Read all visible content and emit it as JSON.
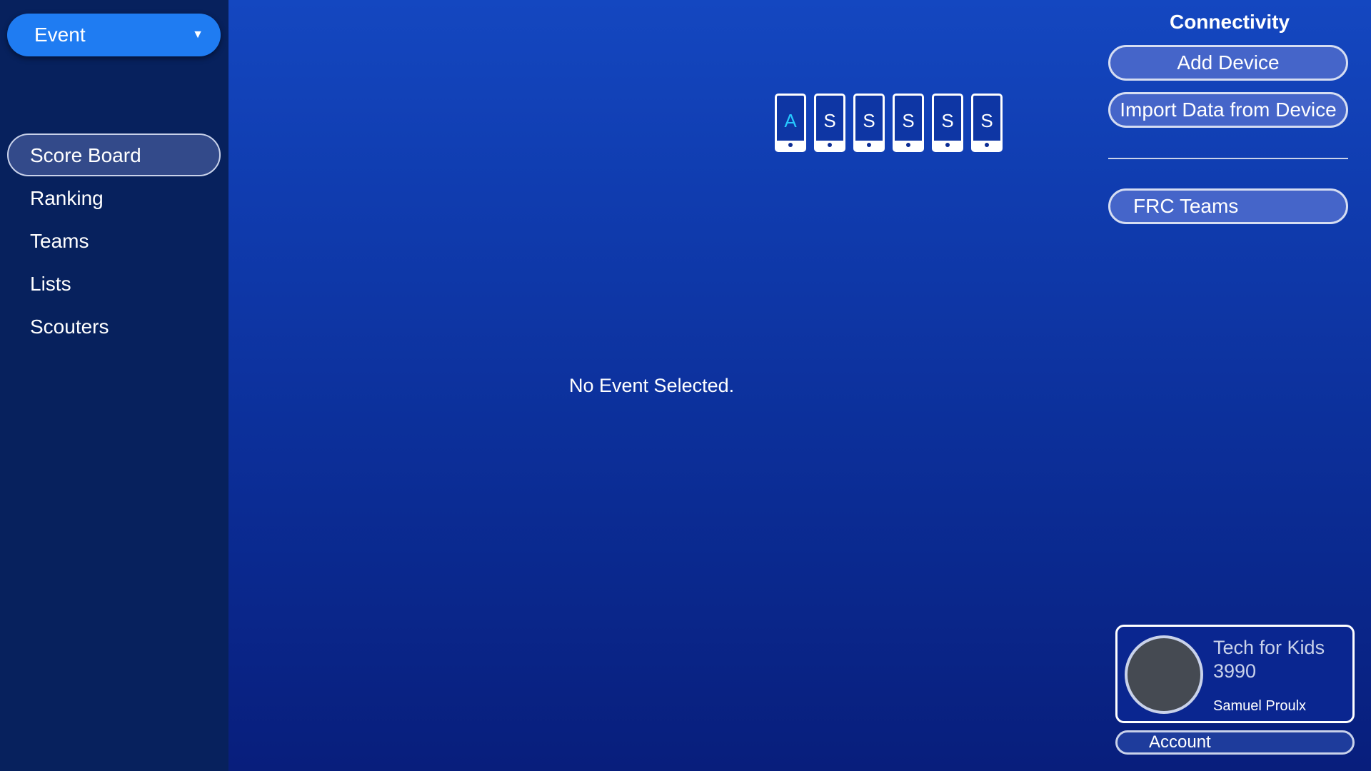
{
  "sidebar": {
    "event_dropdown": {
      "label": "Event",
      "caret": "▼"
    },
    "items": [
      {
        "label": "Score Board",
        "active": true
      },
      {
        "label": "Ranking",
        "active": false
      },
      {
        "label": "Teams",
        "active": false
      },
      {
        "label": "Lists",
        "active": false
      },
      {
        "label": "Scouters",
        "active": false
      }
    ]
  },
  "devices": [
    {
      "letter": "A",
      "color": "#26c8ff"
    },
    {
      "letter": "S",
      "color": "#ffffff"
    },
    {
      "letter": "S",
      "color": "#ffffff"
    },
    {
      "letter": "S",
      "color": "#ffffff"
    },
    {
      "letter": "S",
      "color": "#ffffff"
    },
    {
      "letter": "S",
      "color": "#ffffff"
    }
  ],
  "main": {
    "empty_message": "No Event Selected."
  },
  "connectivity": {
    "title": "Connectivity",
    "add_device": "Add Device",
    "import_data": "Import Data from Device",
    "frc_teams": "FRC Teams"
  },
  "account": {
    "team_name": "Tech for Kids",
    "team_number": "3990",
    "user_name": "Samuel Proulx",
    "account_label": "Account"
  },
  "colors": {
    "accent_blue": "#1f7cf2",
    "device_accent": "#26c8ff",
    "sidebar_bg": "#07215d",
    "avatar_gray": "#454a52"
  }
}
